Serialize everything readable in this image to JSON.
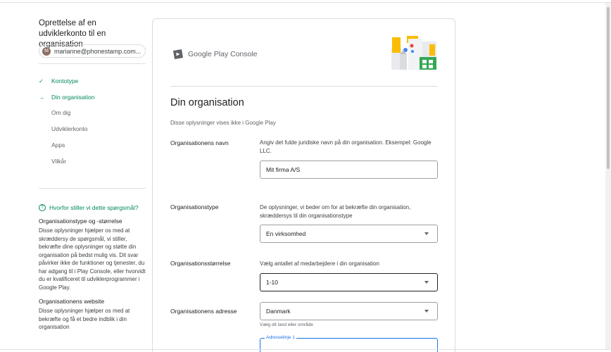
{
  "sidebar": {
    "title": "Oprettelse af en udviklerkonto til en organisation",
    "account_initial": "M",
    "account_email": "marianne@phonestamp.com...",
    "steps": [
      {
        "mark": "✓",
        "label": "Kontotype"
      },
      {
        "mark": "→",
        "label": "Din organisation"
      },
      {
        "mark": "",
        "label": "Om dig"
      },
      {
        "mark": "",
        "label": "Udviklerkonto"
      },
      {
        "mark": "",
        "label": "Apps"
      },
      {
        "mark": "",
        "label": "Vilkår"
      }
    ],
    "why": {
      "icon": "?",
      "link": "Hvorfor stiller vi dette spørgsmål?",
      "heading1": "Organisationstype og -størrelse",
      "text1": "Disse oplysninger hjælper os med at skræddersy de spørgsmål, vi stiller, bekræfte dine oplysninger og støtte din organisation på bedst mulig vis. Dit svar påvirker ikke de funktioner og tjenester, du har adgang til i Play Console, eller hvorvidt du er kvalificeret til udviklerprogrammer i Google Play.",
      "heading2": "Organisationens website",
      "text2": "Disse oplysninger hjælper os med at bekræfte og få et bedre indblik i din organisation"
    }
  },
  "main": {
    "logo_google_play": "Google Play",
    "logo_console": "Console",
    "heading": "Din organisation",
    "subheading": "Disse oplysninger vises ikke i Google Play",
    "org_name": {
      "label": "Organisationens navn",
      "description": "Angiv det fulde juridiske navn på din organisation. Eksempel: Google LLC.",
      "value": "Mit firma A/S"
    },
    "org_type": {
      "label": "Organisationstype",
      "description": "De oplysninger, vi beder om for at bekræfte din organisation, skræddersys til din organisationstype",
      "value": "En virksomhed"
    },
    "org_size": {
      "label": "Organisationsstørrelse",
      "description": "Vælg antallet af medarbejdere i din organisation",
      "value": "1-10"
    },
    "org_address": {
      "label": "Organisationens adresse",
      "country": "Danmark",
      "country_helper": "Vælg dit land eller område",
      "address_line_label": "Adresselinje 1"
    }
  },
  "colors": {
    "accent_green": "#01875f",
    "focus_blue": "#1a73e8"
  }
}
